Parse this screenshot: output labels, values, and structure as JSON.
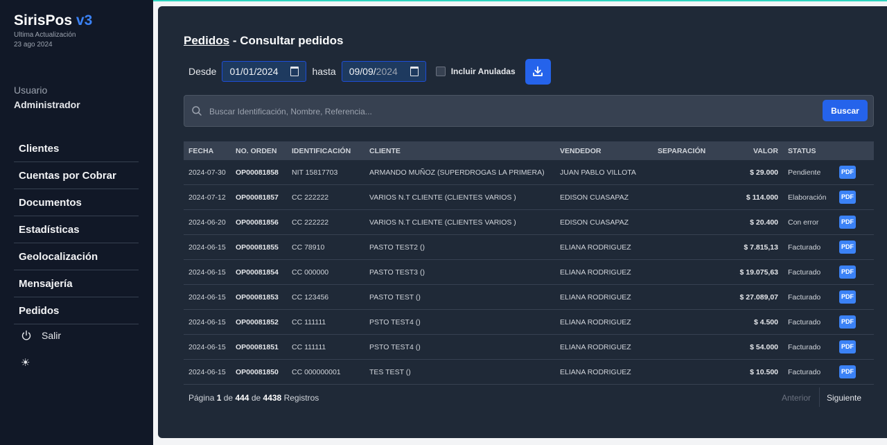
{
  "brand": {
    "name": "SirisPos",
    "version": "v3"
  },
  "update": {
    "label": "Ultima Actualización",
    "date": "23 ago 2024"
  },
  "user": {
    "label": "Usuario",
    "name": "Administrador"
  },
  "nav": [
    {
      "label": "Clientes"
    },
    {
      "label": "Cuentas por Cobrar"
    },
    {
      "label": "Documentos"
    },
    {
      "label": "Estadísticas"
    },
    {
      "label": "Geolocalización"
    },
    {
      "label": "Mensajería"
    },
    {
      "label": "Pedidos"
    }
  ],
  "logout": {
    "label": "Salir",
    "icon": "power-icon"
  },
  "theme": {
    "icon": "sun-icon"
  },
  "page": {
    "crumb": "Pedidos",
    "title": " - Consultar pedidos"
  },
  "filters": {
    "from_label": "Desde",
    "from_value": "01/01/2024",
    "to_label": "hasta",
    "to_value_day_month": "09/09/",
    "to_value_year": "2024",
    "include_void_label": "Incluir Anuladas",
    "include_void_checked": false
  },
  "search": {
    "placeholder": "Buscar Identificación, Nombre, Referencia...",
    "button": "Buscar"
  },
  "table": {
    "columns": [
      "FECHA",
      "NO. ORDEN",
      "IDENTIFICACIÓN",
      "CLIENTE",
      "VENDEDOR",
      "SEPARACIÓN",
      "VALOR",
      "STATUS",
      ""
    ],
    "rows": [
      {
        "fecha": "2024-07-30",
        "orden": "OP00081858",
        "id": "NIT 15817703",
        "cliente": "ARMANDO MUÑOZ (SUPERDROGAS LA PRIMERA)",
        "vendedor": "JUAN PABLO VILLOTA",
        "separacion": "",
        "valor": "$ 29.000",
        "status": "Pendiente",
        "pdf": "PDF"
      },
      {
        "fecha": "2024-07-12",
        "orden": "OP00081857",
        "id": "CC 222222",
        "cliente": "VARIOS N.T CLIENTE (CLIENTES VARIOS )",
        "vendedor": "EDISON CUASAPAZ",
        "separacion": "",
        "valor": "$ 114.000",
        "status": "Elaboración",
        "pdf": "PDF"
      },
      {
        "fecha": "2024-06-20",
        "orden": "OP00081856",
        "id": "CC 222222",
        "cliente": "VARIOS N.T CLIENTE (CLIENTES VARIOS )",
        "vendedor": "EDISON CUASAPAZ",
        "separacion": "",
        "valor": "$ 20.400",
        "status": "Con error",
        "pdf": "PDF"
      },
      {
        "fecha": "2024-06-15",
        "orden": "OP00081855",
        "id": "CC 78910",
        "cliente": "PASTO TEST2 ()",
        "vendedor": "ELIANA RODRIGUEZ",
        "separacion": "",
        "valor": "$ 7.815,13",
        "status": "Facturado",
        "pdf": "PDF"
      },
      {
        "fecha": "2024-06-15",
        "orden": "OP00081854",
        "id": "CC 000000",
        "cliente": "PASTO TEST3 ()",
        "vendedor": "ELIANA RODRIGUEZ",
        "separacion": "",
        "valor": "$ 19.075,63",
        "status": "Facturado",
        "pdf": "PDF"
      },
      {
        "fecha": "2024-06-15",
        "orden": "OP00081853",
        "id": "CC 123456",
        "cliente": "PASTO TEST ()",
        "vendedor": "ELIANA RODRIGUEZ",
        "separacion": "",
        "valor": "$ 27.089,07",
        "status": "Facturado",
        "pdf": "PDF"
      },
      {
        "fecha": "2024-06-15",
        "orden": "OP00081852",
        "id": "CC 111111",
        "cliente": "PSTO TEST4 ()",
        "vendedor": "ELIANA RODRIGUEZ",
        "separacion": "",
        "valor": "$ 4.500",
        "status": "Facturado",
        "pdf": "PDF"
      },
      {
        "fecha": "2024-06-15",
        "orden": "OP00081851",
        "id": "CC 111111",
        "cliente": "PSTO TEST4 ()",
        "vendedor": "ELIANA RODRIGUEZ",
        "separacion": "",
        "valor": "$ 54.000",
        "status": "Facturado",
        "pdf": "PDF"
      },
      {
        "fecha": "2024-06-15",
        "orden": "OP00081850",
        "id": "CC 000000001",
        "cliente": "TES TEST ()",
        "vendedor": "ELIANA RODRIGUEZ",
        "separacion": "",
        "valor": "$ 10.500",
        "status": "Facturado",
        "pdf": "PDF"
      }
    ]
  },
  "pager": {
    "page_word": "Página",
    "current": "1",
    "of_word": "de",
    "total_pages": "444",
    "of_word2": "de",
    "total_records": "4438",
    "records_word": "Registros",
    "prev": "Anterior",
    "next": "Siguiente"
  },
  "colors": {
    "accent": "#2563eb",
    "sidebar": "#111827",
    "panel": "#1f2937",
    "brand_version": "#3b82f6"
  }
}
